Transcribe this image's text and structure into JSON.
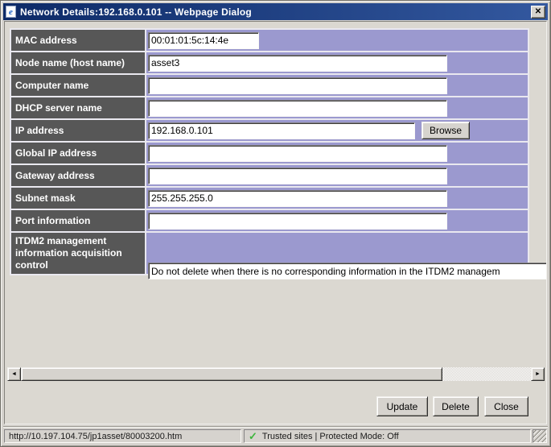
{
  "window": {
    "title": "Network Details:192.168.0.101 -- Webpage Dialog"
  },
  "icons": {
    "ie_glyph": "e",
    "close_glyph": "✕",
    "check_glyph": "✓",
    "scroll_left_glyph": "◄",
    "scroll_right_glyph": "►"
  },
  "colors": {
    "titlebar_left": "#0d2a67",
    "titlebar_right": "#33589f",
    "label_bg": "#575757",
    "value_bg": "#9b99cf",
    "check_green": "#3cb53c"
  },
  "form": {
    "browse_label": "Browse",
    "rows": [
      {
        "label": "MAC address",
        "value": "00:01:01:5c:14:4e"
      },
      {
        "label": "Node name (host name)",
        "value": "asset3"
      },
      {
        "label": "Computer name",
        "value": ""
      },
      {
        "label": "DHCP server name",
        "value": ""
      },
      {
        "label": "IP address",
        "value": "192.168.0.101"
      },
      {
        "label": "Global IP address",
        "value": ""
      },
      {
        "label": "Gateway address",
        "value": ""
      },
      {
        "label": "Subnet mask",
        "value": "255.255.255.0"
      },
      {
        "label": "Port information",
        "value": ""
      },
      {
        "label": "ITDM2 management information acquisition control",
        "value": "Do not delete when there is no corresponding information in the ITDM2 managem"
      }
    ]
  },
  "footer": {
    "buttons": [
      {
        "label": "Update"
      },
      {
        "label": "Delete"
      },
      {
        "label": "Close"
      }
    ]
  },
  "statusbar": {
    "url": "http://10.197.104.75/jp1asset/80003200.htm",
    "zone": "Trusted sites | Protected Mode: Off"
  }
}
